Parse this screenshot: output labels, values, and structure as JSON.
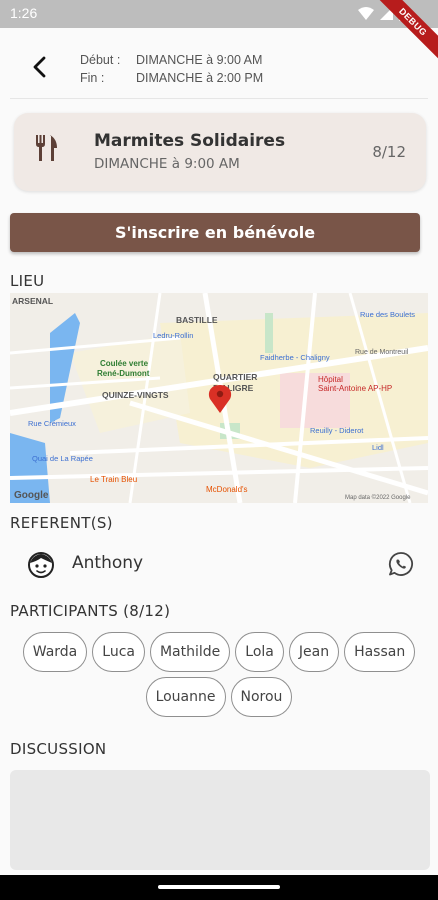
{
  "status_bar": {
    "time": "1:26",
    "debug_banner": "DEBUG"
  },
  "header": {
    "start_label": "Début :",
    "start_value": "DIMANCHE à 9:00 AM",
    "end_label": "Fin :",
    "end_value": "DIMANCHE à 2:00 PM"
  },
  "event": {
    "title": "Marmites Solidaires",
    "subtitle": "DIMANCHE à 9:00 AM",
    "count": "8/12"
  },
  "signup_button": "S'inscrire en bénévole",
  "sections": {
    "lieu": "LIEU",
    "referents": "REFERENT(S)",
    "participants": "PARTICIPANTS (8/12)",
    "discussion": "DISCUSSION"
  },
  "map": {
    "labels": {
      "arsenal": "ARSENAL",
      "bastille": "BASTILLE",
      "ledru": "Ledru-Rollin",
      "faidherbe": "Faidherbe - Chaligny",
      "quinze": "QUINZE-VINGTS",
      "quartier": "QUARTIER",
      "aligre": "D'ALIGRE",
      "coulee1": "Coulée verte",
      "coulee2": "René-Dumont",
      "hopital1": "Hôpital",
      "hopital2": "Saint-Antoine AP-HP",
      "reuilly": "Reuilly - Diderot",
      "cremieux": "Rue Crémieux",
      "rapee": "Quai de La Rapée",
      "train": "Le Train Bleu",
      "mcdo": "McDonald's",
      "lidl": "Lidl",
      "boulets": "Rue des Boulets",
      "montreuil": "Rue de Montreuil",
      "google": "Google",
      "mapdata": "Map data ©2022 Google"
    }
  },
  "referent": {
    "name": "Anthony"
  },
  "participants": [
    "Warda",
    "Luca",
    "Mathilde",
    "Lola",
    "Jean",
    "Hassan",
    "Louanne",
    "Norou"
  ],
  "colors": {
    "accent": "#795548",
    "card": "#f0e9e5",
    "pin": "#d93025"
  }
}
